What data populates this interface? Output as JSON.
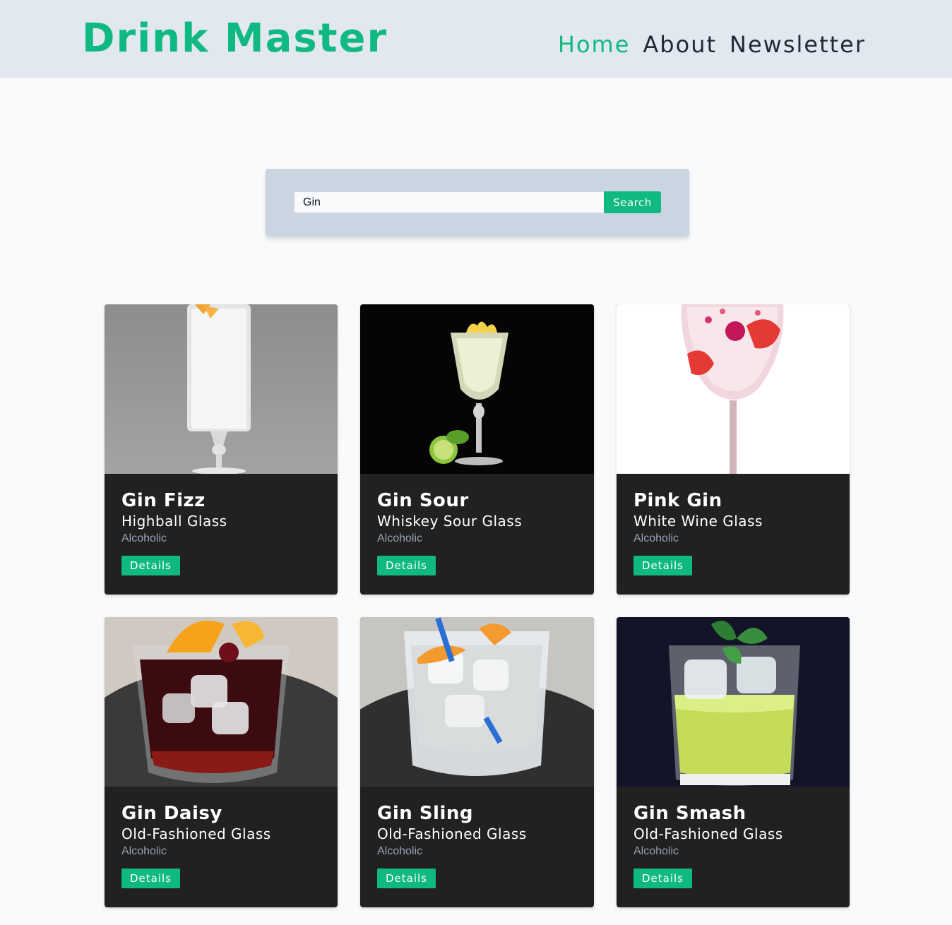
{
  "header": {
    "logo": "Drink Master",
    "nav": [
      {
        "label": "Home"
      },
      {
        "label": "About"
      },
      {
        "label": "Newsletter"
      }
    ]
  },
  "search": {
    "value": "Gin",
    "button_label": "Search"
  },
  "drinks": [
    {
      "name": "Gin Fizz",
      "glass": "Highball Glass",
      "category": "Alcoholic",
      "details_label": "Details"
    },
    {
      "name": "Gin Sour",
      "glass": "Whiskey Sour Glass",
      "category": "Alcoholic",
      "details_label": "Details"
    },
    {
      "name": "Pink Gin",
      "glass": "White Wine Glass",
      "category": "Alcoholic",
      "details_label": "Details"
    },
    {
      "name": "Gin Daisy",
      "glass": "Old-Fashioned Glass",
      "category": "Alcoholic",
      "details_label": "Details"
    },
    {
      "name": "Gin Sling",
      "glass": "Old-Fashioned Glass",
      "category": "Alcoholic",
      "details_label": "Details"
    },
    {
      "name": "Gin Smash",
      "glass": "Old-Fashioned Glass",
      "category": "Alcoholic",
      "details_label": "Details"
    }
  ],
  "colors": {
    "accent": "#10b981",
    "header_bg": "#e2e8f0",
    "card_bg": "#212121",
    "muted": "#94a3b8"
  }
}
